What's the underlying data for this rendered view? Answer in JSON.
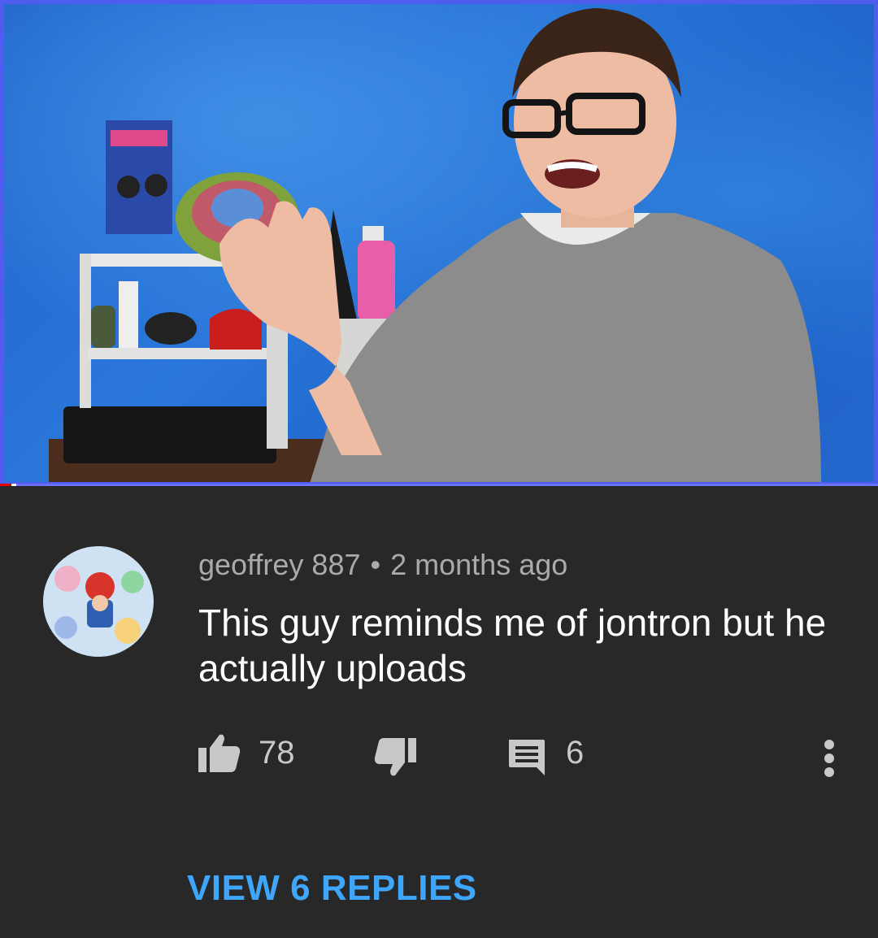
{
  "video": {
    "thumbnail": "man-waving-in-front-of-blue-wall",
    "progress_fraction": 0.013,
    "colors": {
      "border": "#4e5cf0",
      "progress_played": "#e00000",
      "progress_track": "#6a70ff"
    }
  },
  "comment": {
    "avatar": "avatar-image",
    "author": "geoffrey 887",
    "separator": "•",
    "timestamp": "2 months ago",
    "text": "This guy reminds me of jontron but he actually uploads",
    "like_icon": "thumbs-up-icon",
    "like_count": "78",
    "dislike_icon": "thumbs-down-icon",
    "reply_icon": "comment-icon",
    "reply_count": "6",
    "more_icon": "more-vertical-icon",
    "view_replies_label": "VIEW 6 REPLIES"
  },
  "colors": {
    "background": "#282828",
    "meta_text": "#aaaaaa",
    "accent": "#3ea6ff"
  }
}
